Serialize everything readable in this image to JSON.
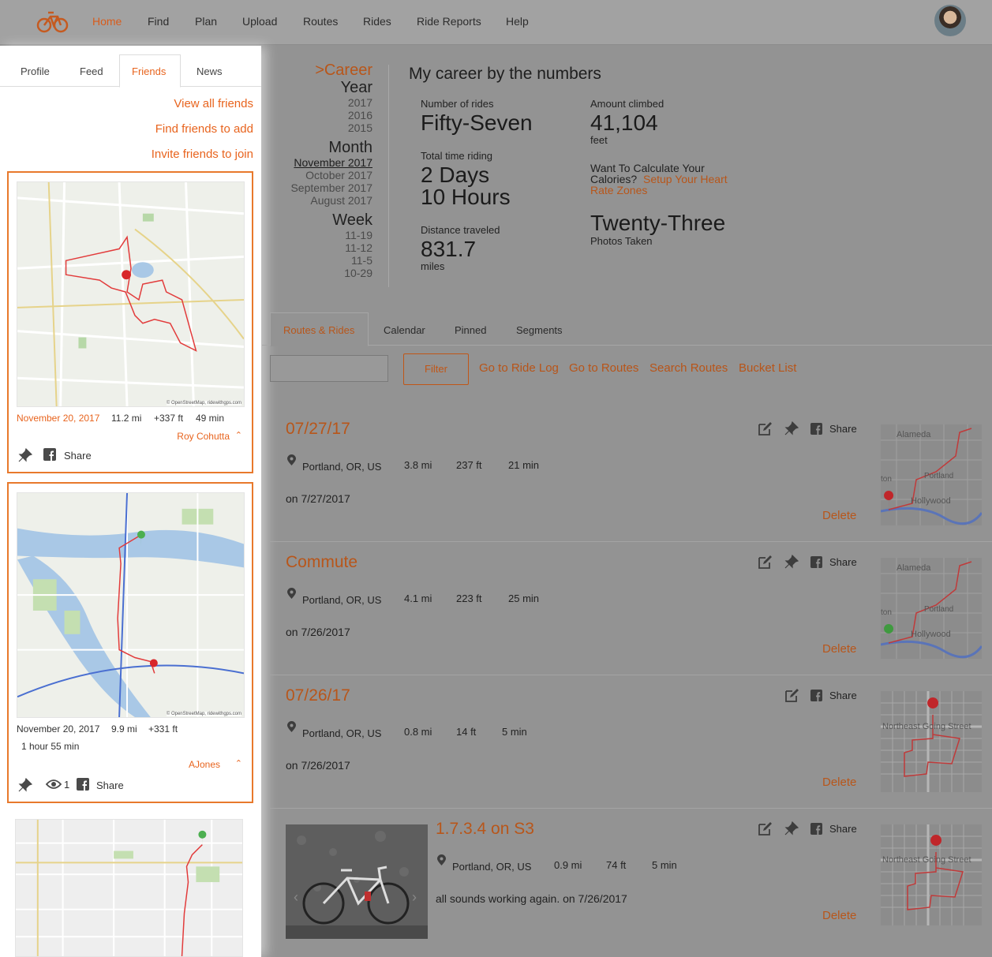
{
  "nav": {
    "items": [
      "Home",
      "Find",
      "Plan",
      "Upload",
      "Routes",
      "Rides",
      "Ride Reports",
      "Help"
    ],
    "active": "Home"
  },
  "left": {
    "tabs": [
      "Profile",
      "Feed",
      "Friends",
      "News"
    ],
    "active_tab": "Friends",
    "links": [
      "View all friends",
      "Find friends to add",
      "Invite friends to join"
    ],
    "cards": [
      {
        "date": "November 20, 2017",
        "distance": "11.2 mi",
        "elevation": "+337 ft",
        "duration": "49 min",
        "author": "Roy Cohutta",
        "share": "Share",
        "attribution": "© OpenStreetMap, ridewithgps.com"
      },
      {
        "date": "November 20, 2017",
        "distance": "9.9 mi",
        "elevation": "+331 ft",
        "duration": "1 hour 55 min",
        "author": "AJones",
        "views": "1",
        "share": "Share",
        "attribution": "© OpenStreetMap, ridewithgps.com"
      }
    ]
  },
  "career_nav": {
    "career": ">Career",
    "year_heading": "Year",
    "years": [
      "2017",
      "2016",
      "2015"
    ],
    "month_heading": "Month",
    "months": [
      "November 2017",
      "October 2017",
      "September 2017",
      "August 2017"
    ],
    "week_heading": "Week",
    "weeks": [
      "11-19",
      "11-12",
      "11-5",
      "10-29"
    ]
  },
  "career": {
    "title": "My career by the numbers",
    "rides_label": "Number of rides",
    "rides_value": "Fifty-Seven",
    "time_label": "Total time riding",
    "time_value_1": "2 Days",
    "time_value_2": "10 Hours",
    "distance_label": "Distance traveled",
    "distance_value": "831.7",
    "distance_unit": "miles",
    "climb_label": "Amount climbed",
    "climb_value": "41,104",
    "climb_unit": "feet",
    "calories_prompt_1": "Want To Calculate Your",
    "calories_prompt_2": "Calories?",
    "calories_link_1": "Setup Your Heart",
    "calories_link_2": "Rate Zones",
    "photos_value": "Twenty-Three",
    "photos_label": "Photos Taken"
  },
  "main_tabs": [
    "Routes & Rides",
    "Calendar",
    "Pinned",
    "Segments"
  ],
  "toolbar": {
    "filter": "Filter",
    "links": [
      "Go to Ride Log",
      "Go to Routes",
      "Search Routes",
      "Bucket List"
    ]
  },
  "rides": [
    {
      "title": "07/27/17",
      "location": "Portland, OR, US",
      "distance": "3.8 mi",
      "elevation": "237 ft",
      "duration": "21 min",
      "note": "on 7/27/2017",
      "share": "Share",
      "delete": "Delete",
      "thumb_labels": [
        "Alameda",
        "Portland",
        "Hollywood",
        "ton"
      ]
    },
    {
      "title": "Commute",
      "location": "Portland, OR, US",
      "distance": "4.1 mi",
      "elevation": "223 ft",
      "duration": "25 min",
      "note": "on 7/26/2017",
      "share": "Share",
      "delete": "Delete",
      "thumb_labels": [
        "Alameda",
        "Portland",
        "Hollywood",
        "ton"
      ]
    },
    {
      "title": "07/26/17",
      "location": "Portland, OR, US",
      "distance": "0.8 mi",
      "elevation": "14 ft",
      "duration": "5 min",
      "note": "on 7/26/2017",
      "share": "Share",
      "delete": "Delete",
      "thumb_labels": [
        "Northeast Going Street"
      ]
    },
    {
      "title": "1.7.3.4 on S3",
      "location": "Portland, OR, US",
      "distance": "0.9 mi",
      "elevation": "74 ft",
      "duration": "5 min",
      "note": "all sounds working again. on 7/26/2017",
      "share": "Share",
      "delete": "Delete",
      "thumb_labels": [
        "Northeast Going Street"
      ]
    }
  ]
}
